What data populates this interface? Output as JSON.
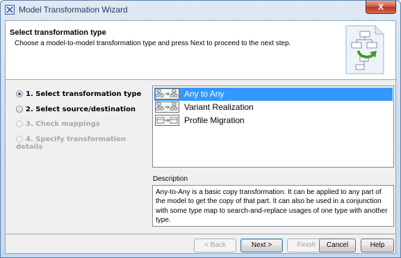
{
  "window": {
    "title": "Model Transformation Wizard",
    "close_label": "X"
  },
  "header": {
    "title": "Select transformation type",
    "description": "Choose a model-to-model transformation type and press Next to proceed to the next step."
  },
  "steps": [
    {
      "label": "1. Select transformation type",
      "selected": true,
      "enabled": true
    },
    {
      "label": "2. Select source/destination",
      "selected": false,
      "enabled": true
    },
    {
      "label": "3. Check mappings",
      "selected": false,
      "enabled": false
    },
    {
      "label": "4. Specify transformation details",
      "selected": false,
      "enabled": false
    }
  ],
  "transformations": [
    {
      "label": "Any to Any",
      "icon": "any-to-any-icon",
      "selected": true
    },
    {
      "label": "Variant Realization",
      "icon": "variant-realization-icon",
      "selected": false
    },
    {
      "label": "Profile Migration",
      "icon": "profile-migration-icon",
      "selected": false
    }
  ],
  "description": {
    "label": "Description",
    "text": "Any-to-Any is a basic copy transformation. It can be applied to any part of the model to get the copy of that part. It can also be used in a conjunction with some type map to search-and-replace usages of one type with another type."
  },
  "buttons": {
    "back": "< Back",
    "next": "Next >",
    "finish": "Finish",
    "cancel": "Cancel",
    "help": "Help"
  },
  "colors": {
    "selection": "#3399ff",
    "disabled_text": "#a8a8a8",
    "close_button": "#c8533d"
  }
}
